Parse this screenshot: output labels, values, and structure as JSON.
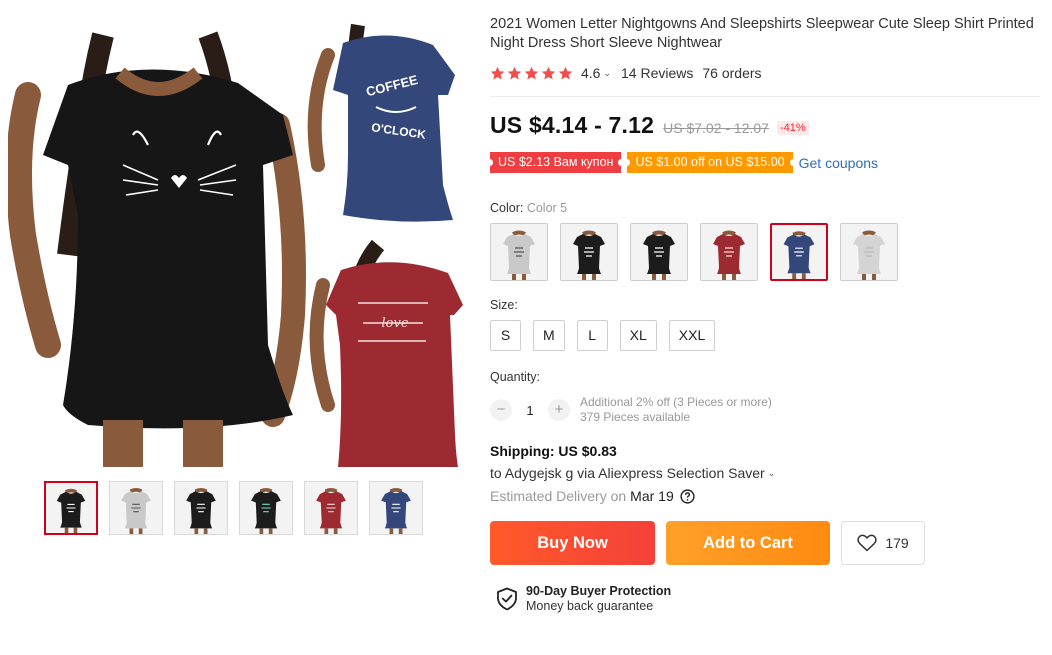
{
  "product": {
    "title": "2021 Women Letter Nightgowns And Sleepshirts Sleepwear Cute Sleep Shirt Printed Night Dress Short Sleeve Nightwear",
    "rating": "4.6",
    "reviews": "14 Reviews",
    "orders": "76 orders",
    "price": "US $4.14 - 7.12",
    "old_price": "US $7.02 - 12.07",
    "discount": "-41%"
  },
  "coupons": {
    "seller_coupon": "US $2.13 Вам купон",
    "store_coupon": "US $1.00 off on US $15.00",
    "get_coupons": "Get coupons"
  },
  "color": {
    "label": "Color:",
    "selected": "Color 5",
    "options": [
      {
        "dress": "#c9c9c9",
        "print": "#555555"
      },
      {
        "dress": "#1c1c1c",
        "print": "#ffffff"
      },
      {
        "dress": "#1c1c1c",
        "print": "#ffffff"
      },
      {
        "dress": "#9c2a30",
        "print": "#f5dede"
      },
      {
        "dress": "#34477a",
        "print": "#ffffff"
      },
      {
        "dress": "#d4d4d4",
        "print": "#bbbbbb"
      }
    ],
    "selected_index": 4
  },
  "size": {
    "label": "Size:",
    "options": [
      "S",
      "M",
      "L",
      "XL",
      "XXL"
    ]
  },
  "quantity": {
    "label": "Quantity:",
    "value": "1",
    "minus": "−",
    "plus": "+",
    "note_discount": "Additional 2% off (3 Pieces or more)",
    "note_available": "379 Pieces available"
  },
  "shipping": {
    "title": "Shipping: US $0.83",
    "to": "to Adygejsk g via Aliexpress Selection Saver",
    "delivery_prefix": "Estimated Delivery on",
    "delivery_date": "Mar 19"
  },
  "actions": {
    "buy_now": "Buy Now",
    "add_to_cart": "Add to Cart",
    "wishlist_count": "179"
  },
  "protection": {
    "title": "90-Day Buyer Protection",
    "subtitle": "Money back guarantee"
  },
  "gallery": {
    "thumbnails": [
      {
        "dress": "#1c1c1c",
        "print": "#ffffff"
      },
      {
        "dress": "#c9c9c9",
        "print": "#555555"
      },
      {
        "dress": "#1c1c1c",
        "print": "#ffffff"
      },
      {
        "dress": "#1c1c1c",
        "print": "#6ee0c8"
      },
      {
        "dress": "#9c2a30",
        "print": "#f5dede"
      },
      {
        "dress": "#34477a",
        "print": "#ffffff"
      }
    ],
    "selected_index": 0,
    "main_image_texts": {
      "coffee": "COFFEE",
      "oclock": "O'CLOCK",
      "love": "love"
    }
  },
  "colors": {
    "star": "#f44b4b",
    "accent_red": "#d0021b",
    "link_blue": "#2e6fb5"
  }
}
